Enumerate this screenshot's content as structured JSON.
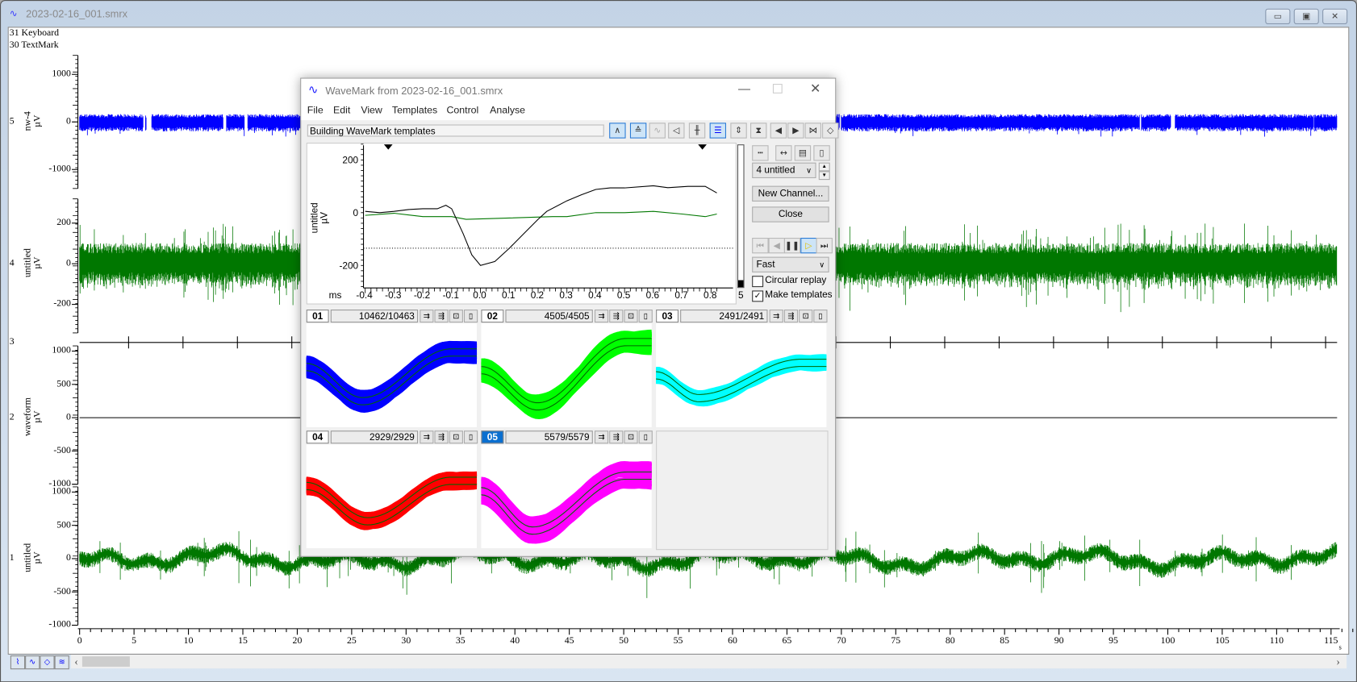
{
  "window": {
    "title": "2023-02-16_001.smrx",
    "min_label": "▭",
    "restore_label": "▣",
    "close_label": "✕"
  },
  "markers": [
    "31 Keyboard",
    "30 TextMark"
  ],
  "channels": [
    {
      "number": "5",
      "name": "nw-4",
      "unit": "µV",
      "ticks": [
        "1000",
        "0",
        "-1000"
      ],
      "color": "#0000ff"
    },
    {
      "number": "4",
      "name": "untitled",
      "unit": "µV",
      "ticks": [
        "200",
        "0",
        "-200"
      ],
      "color": "#007700"
    },
    {
      "number": "3",
      "name": "",
      "unit": "",
      "ticks": [],
      "color": "#000000"
    },
    {
      "number": "2",
      "name": "waveform",
      "unit": "µV",
      "ticks": [
        "1000",
        "500",
        "0",
        "-500",
        "-1000"
      ],
      "color": "#000000"
    },
    {
      "number": "1",
      "name": "untitled",
      "unit": "µV",
      "ticks": [
        "1000",
        "500",
        "0",
        "-500",
        "-1000"
      ],
      "color": "#007700"
    }
  ],
  "time_axis": {
    "labels": [
      "0",
      "5",
      "10",
      "15",
      "20",
      "25",
      "30",
      "35",
      "40",
      "45",
      "50",
      "55",
      "60",
      "65",
      "70",
      "75",
      "80",
      "85",
      "90",
      "95",
      "100",
      "105",
      "110",
      "115"
    ],
    "unit": "s"
  },
  "bottom_toolbar": {
    "scroll_left": "‹",
    "scroll_right": "›"
  },
  "dialog": {
    "title": "WaveMark from 2023-02-16_001.smrx",
    "menu": [
      "File",
      "Edit",
      "View",
      "Templates",
      "Control",
      "Analyse"
    ],
    "status": "Building WaveMark templates",
    "plot": {
      "ylabel": "untitled",
      "yunit": "µV",
      "yticks": [
        "200",
        "0",
        "-200"
      ],
      "xunit": "ms",
      "xticks": [
        "-0.4",
        "-0.3",
        "-0.2",
        "-0.1",
        "0.0",
        "0.1",
        "0.2",
        "0.3",
        "0.4",
        "0.5",
        "0.6",
        "0.7",
        "0.8"
      ],
      "slider_value": "5"
    },
    "channel_select": "4 untitled",
    "new_channel": "New Channel...",
    "close": "Close",
    "speed": "Fast",
    "circular_replay": {
      "label": "Circular replay",
      "checked": false
    },
    "make_templates": {
      "label": "Make templates",
      "checked": true
    },
    "templates": [
      {
        "id": "01",
        "count": "10462/10463",
        "color": "#0000ff",
        "selected": false
      },
      {
        "id": "02",
        "count": "4505/4505",
        "color": "#00ff00",
        "selected": false
      },
      {
        "id": "03",
        "count": "2491/2491",
        "color": "#00ffff",
        "selected": false
      },
      {
        "id": "04",
        "count": "2929/2929",
        "color": "#ff0000",
        "selected": false
      },
      {
        "id": "05",
        "count": "5579/5579",
        "color": "#ff00ff",
        "selected": true
      }
    ]
  }
}
